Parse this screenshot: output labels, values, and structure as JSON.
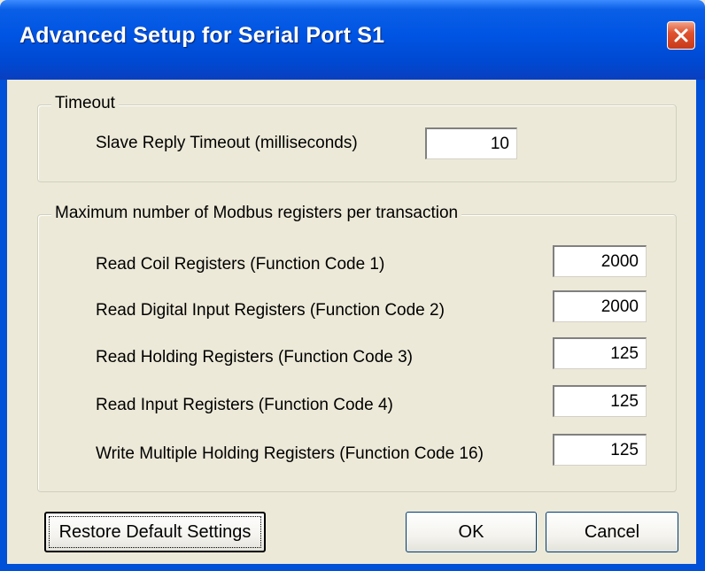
{
  "window": {
    "title": "Advanced Setup for Serial Port S1"
  },
  "timeout_group": {
    "legend": "Timeout",
    "slave_reply_label": "Slave Reply Timeout (milliseconds)",
    "slave_reply_value": "10"
  },
  "registers_group": {
    "legend": "Maximum number of Modbus registers per transaction",
    "rows": [
      {
        "label": "Read Coil Registers (Function Code 1)",
        "value": "2000"
      },
      {
        "label": "Read Digital Input Registers (Function Code 2)",
        "value": "2000"
      },
      {
        "label": "Read Holding Registers (Function Code 3)",
        "value": "125"
      },
      {
        "label": "Read Input Registers (Function Code 4)",
        "value": "125"
      },
      {
        "label": "Write Multiple Holding Registers (Function Code 16)",
        "value": "125"
      }
    ]
  },
  "buttons": {
    "restore_label": "Restore Default Settings",
    "ok_label": "OK",
    "cancel_label": "Cancel"
  },
  "colors": {
    "titlebar": "#0054e3",
    "dialog_bg": "#ece9d8",
    "close_button": "#e0522f"
  },
  "icons": {
    "close": "close-icon"
  }
}
